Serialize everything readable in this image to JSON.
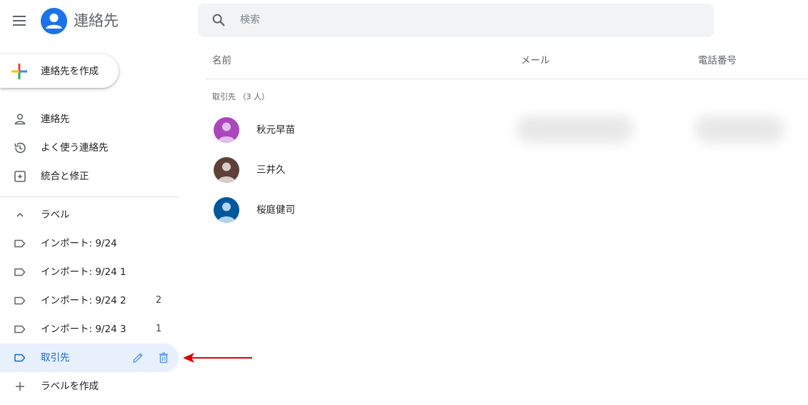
{
  "header": {
    "title": "連絡先",
    "search_placeholder": "検索"
  },
  "create_button": {
    "label": "連絡先を作成"
  },
  "sidebar": {
    "items": [
      {
        "label": "連絡先",
        "icon": "person-icon"
      },
      {
        "label": "よく使う連絡先",
        "icon": "history-icon"
      },
      {
        "label": "統合と修正",
        "icon": "merge-icon"
      }
    ],
    "labels_header": "ラベル",
    "labels": [
      {
        "label": "インポート: 9/24",
        "count": ""
      },
      {
        "label": "インポート: 9/24 1",
        "count": ""
      },
      {
        "label": "インポート: 9/24 2",
        "count": "2"
      },
      {
        "label": "インポート: 9/24 3",
        "count": "1"
      },
      {
        "label": "取引先",
        "count": "",
        "active": true
      }
    ],
    "create_label": "ラベルを作成"
  },
  "table": {
    "columns": {
      "name": "名前",
      "email": "メール",
      "phone": "電話番号"
    },
    "group_label": "取引先 （3 人）",
    "rows": [
      {
        "name": "秋元早苗",
        "avatar_color": "#ab47bc",
        "avatar_fg": "#e1bee7"
      },
      {
        "name": "三井久",
        "avatar_color": "#5d4037",
        "avatar_fg": "#d7ccc8"
      },
      {
        "name": "桜庭健司",
        "avatar_color": "#01579b",
        "avatar_fg": "#b3d4ee"
      }
    ]
  },
  "colors": {
    "accent": "#1a73e8",
    "active_bg": "#e8f0fe",
    "annotation_arrow": "#e00000"
  }
}
